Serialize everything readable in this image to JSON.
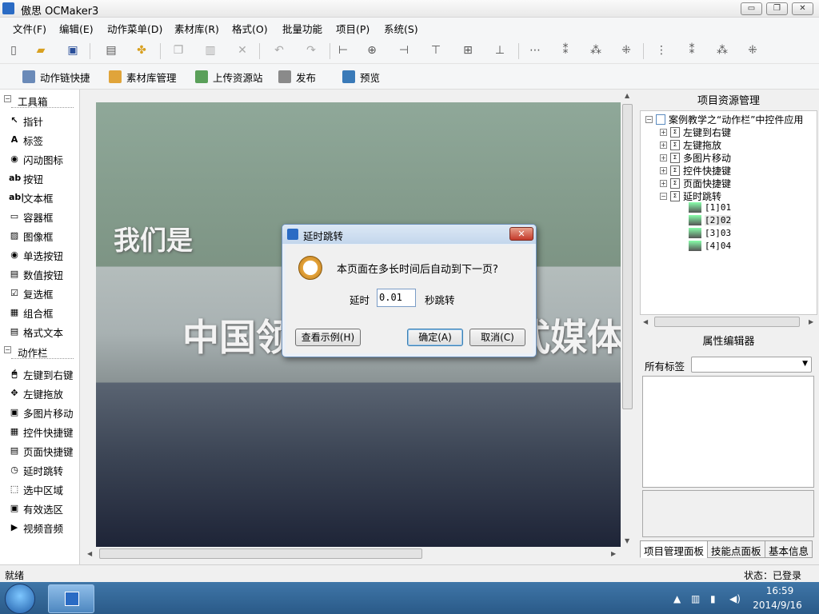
{
  "window": {
    "title": "傲思 OCMaker3",
    "min": "▭",
    "max": "❐",
    "close": "✕"
  },
  "menu": [
    "文件(F)",
    "编辑(E)",
    "动作菜单(D)",
    "素材库(R)",
    "格式(O)",
    "批量功能",
    "项目(P)",
    "系统(S)"
  ],
  "toolbar2": [
    "动作链快捷",
    "素材库管理",
    "上传资源站",
    "发布",
    "预览"
  ],
  "toolbox": {
    "section1": "工具箱",
    "items1": [
      {
        "label": "指针",
        "icon": "pointer-icon",
        "glyph": "↖"
      },
      {
        "label": "标签",
        "icon": "label-icon",
        "glyph": "A"
      },
      {
        "label": "闪动图标",
        "icon": "flash-icon",
        "glyph": "◉"
      },
      {
        "label": "按钮",
        "icon": "button-icon",
        "glyph": "ab"
      },
      {
        "label": "文本框",
        "icon": "textbox-icon",
        "glyph": "ab|"
      },
      {
        "label": "容器框",
        "icon": "container-icon",
        "glyph": "▭"
      },
      {
        "label": "图像框",
        "icon": "image-icon",
        "glyph": "▨"
      },
      {
        "label": "单选按钮",
        "icon": "radio-icon",
        "glyph": "◉"
      },
      {
        "label": "数值按钮",
        "icon": "numeric-icon",
        "glyph": "▤"
      },
      {
        "label": "复选框",
        "icon": "checkbox-icon",
        "glyph": "☑"
      },
      {
        "label": "组合框",
        "icon": "combo-icon",
        "glyph": "▦"
      },
      {
        "label": "格式文本",
        "icon": "richtext-icon",
        "glyph": "▤"
      }
    ],
    "section2": "动作栏",
    "items2": [
      {
        "label": "左键到右键",
        "icon": "mouse-icon",
        "glyph": "🖱"
      },
      {
        "label": "左键拖放",
        "icon": "drag-icon",
        "glyph": "✥"
      },
      {
        "label": "多图片移动",
        "icon": "multi-image-icon",
        "glyph": "▣"
      },
      {
        "label": "控件快捷键",
        "icon": "control-shortcut-icon",
        "glyph": "▦"
      },
      {
        "label": "页面快捷键",
        "icon": "page-shortcut-icon",
        "glyph": "▤"
      },
      {
        "label": "延时跳转",
        "icon": "delay-icon",
        "glyph": "◷"
      },
      {
        "label": "选中区域",
        "icon": "select-area-icon",
        "glyph": "⬚"
      },
      {
        "label": "有效选区",
        "icon": "valid-area-icon",
        "glyph": "▣"
      },
      {
        "label": "视频音频",
        "icon": "media-icon",
        "glyph": "▶"
      }
    ]
  },
  "stage": {
    "text1": "我们是",
    "text2": "中国领先的多媒体形式媒体"
  },
  "project_panel": {
    "title": "项目资源管理",
    "root": "案例教学之“动作栏”中控件应用",
    "nodes": [
      "左键到右键",
      "左键拖放",
      "多图片移动",
      "控件快捷键",
      "页面快捷键",
      "延时跳转"
    ],
    "pages": [
      "[1]01",
      "[2]02",
      "[3]03",
      "[4]04"
    ]
  },
  "property_panel": {
    "title": "属性编辑器",
    "label": "所有标签"
  },
  "tabs": [
    "项目管理面板",
    "技能点面板",
    "基本信息"
  ],
  "status": {
    "left": "就绪",
    "right": "状态：已登录"
  },
  "clock": {
    "time": "16:59",
    "date": "2014/9/16"
  },
  "dialog": {
    "title": "延时跳转",
    "message": "本页面在多长时间后自动到下一页?",
    "delay_label": "延时",
    "delay_value": "0.01",
    "unit_label": "秒跳转",
    "example_btn": "查看示例(H)",
    "ok_btn": "确定(A)",
    "cancel_btn": "取消(C)"
  }
}
